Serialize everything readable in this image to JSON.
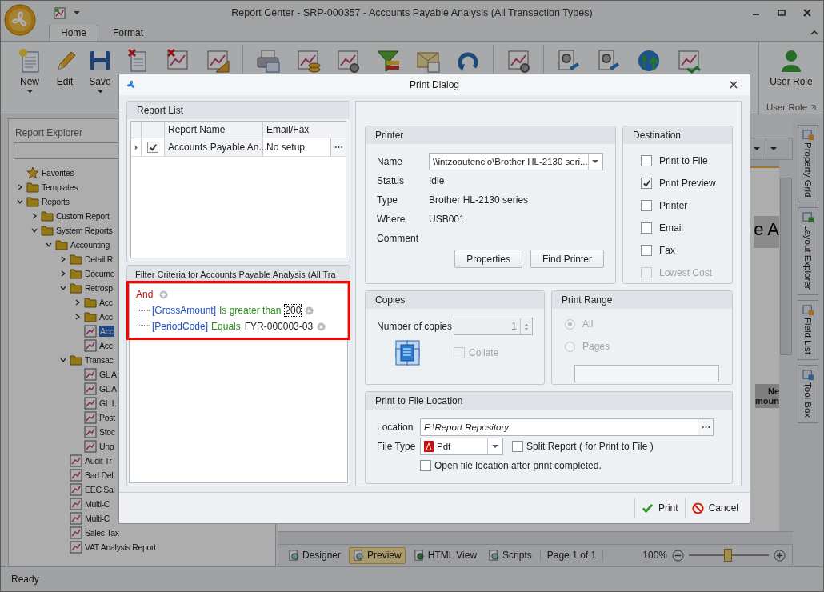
{
  "window": {
    "title": "Report Center - SRP-000357 - Accounts Payable Analysis (All Transaction Types)"
  },
  "ribbon": {
    "tabs": [
      {
        "label": "Home",
        "selected": true
      },
      {
        "label": "Format",
        "selected": false
      }
    ],
    "buttons": [
      {
        "label": "New",
        "dropdown": true
      },
      {
        "label": "Edit",
        "dropdown": false
      },
      {
        "label": "Save",
        "dropdown": true
      }
    ],
    "user_role": {
      "button": "User Role",
      "group": "User Role"
    }
  },
  "report_explorer": {
    "title": "Report Explorer",
    "tree": [
      {
        "label": "Favorites",
        "kind": "favorites",
        "selected": false
      },
      {
        "label": "Templates",
        "kind": "folder",
        "expanded": false,
        "selected": false
      },
      {
        "label": "Reports",
        "kind": "folder",
        "expanded": true,
        "selected": false,
        "children": [
          {
            "label": "Custom Report",
            "kind": "folder",
            "expanded": false,
            "selected": false
          },
          {
            "label": "System Reports",
            "kind": "folder",
            "expanded": true,
            "selected": false,
            "children": [
              {
                "label": "Accounting",
                "kind": "folder",
                "expanded": true,
                "selected": false,
                "children": [
                  {
                    "label": "Detail R",
                    "kind": "folder",
                    "expanded": false,
                    "selected": false
                  },
                  {
                    "label": "Docume",
                    "kind": "folder",
                    "expanded": false,
                    "selected": false
                  },
                  {
                    "label": "Retrosp",
                    "kind": "folder",
                    "expanded": true,
                    "selected": false,
                    "children": [
                      {
                        "label": "Acc",
                        "kind": "folder",
                        "expanded": false,
                        "selected": false
                      },
                      {
                        "label": "Acc",
                        "kind": "folder",
                        "expanded": false,
                        "selected": false
                      },
                      {
                        "label": "Acc",
                        "kind": "report",
                        "selected": true
                      },
                      {
                        "label": "Acc",
                        "kind": "report",
                        "selected": false
                      }
                    ]
                  },
                  {
                    "label": "Transac",
                    "kind": "folder",
                    "expanded": true,
                    "selected": false,
                    "children": [
                      {
                        "label": "GL A",
                        "kind": "report",
                        "selected": false
                      },
                      {
                        "label": "GL A",
                        "kind": "report",
                        "selected": false
                      },
                      {
                        "label": "GL L",
                        "kind": "report",
                        "selected": false
                      },
                      {
                        "label": "Post",
                        "kind": "report",
                        "selected": false
                      },
                      {
                        "label": "Stoc",
                        "kind": "report",
                        "selected": false
                      },
                      {
                        "label": "Unp",
                        "kind": "report",
                        "selected": false
                      }
                    ]
                  },
                  {
                    "label": "Audit Tr",
                    "kind": "report",
                    "selected": false
                  },
                  {
                    "label": "Bad Del",
                    "kind": "report",
                    "selected": false
                  },
                  {
                    "label": "EEC Sal",
                    "kind": "report",
                    "selected": false
                  },
                  {
                    "label": "Multi-C",
                    "kind": "report",
                    "selected": false
                  },
                  {
                    "label": "Multi-C",
                    "kind": "report",
                    "selected": false
                  },
                  {
                    "label": "Sales Tax",
                    "kind": "report",
                    "selected": false
                  },
                  {
                    "label": "VAT Analysis Report",
                    "kind": "report",
                    "selected": false
                  }
                ]
              }
            ]
          }
        ]
      }
    ]
  },
  "preview": {
    "heading_fragment": "e A",
    "column_fragments": [
      "Ne",
      "moun"
    ]
  },
  "dock_tabs": [
    "Property Grid",
    "Layout Explorer",
    "Field List",
    "Tool Box"
  ],
  "preview_toolbar": {
    "modes": [
      {
        "label": "Designer",
        "selected": false
      },
      {
        "label": "Preview",
        "selected": true
      },
      {
        "label": "HTML View",
        "selected": false
      },
      {
        "label": "Scripts",
        "selected": false
      }
    ],
    "page": "Page 1 of 1",
    "zoom": "100%",
    "zoom_slider": {
      "level": 0.48
    }
  },
  "status_bar": "Ready",
  "dialog": {
    "title": "Print Dialog",
    "report_list": {
      "title": "Report List",
      "columns": [
        "Report Name",
        "Email/Fax"
      ],
      "rows": [
        {
          "checked": true,
          "name": "Accounts Payable An...",
          "email_fax": "No setup"
        }
      ]
    },
    "filter": {
      "title": "Filter Criteria for Accounts Payable Analysis (All Tra",
      "group": "And",
      "conditions": [
        {
          "field": "[GrossAmount]",
          "operator": "Is greater than",
          "value": "200",
          "focused": true
        },
        {
          "field": "[PeriodCode]",
          "operator": "Equals",
          "value": "FYR-000003-03",
          "focused": false
        }
      ]
    },
    "printer": {
      "title": "Printer",
      "name_label": "Name",
      "name": "\\\\intzoautencio\\Brother HL-2130 seri...",
      "fields": [
        {
          "label": "Status",
          "value": "Idle"
        },
        {
          "label": "Type",
          "value": "Brother HL-2130 series"
        },
        {
          "label": "Where",
          "value": "USB001"
        },
        {
          "label": "Comment"
        }
      ],
      "buttons": [
        "Properties",
        "Find Printer"
      ]
    },
    "destination": {
      "title": "Destination",
      "options": [
        {
          "label": "Print to File",
          "checked": false,
          "disabled": false
        },
        {
          "label": "Print Preview",
          "checked": true,
          "disabled": false
        },
        {
          "label": "Printer",
          "checked": false,
          "disabled": false
        },
        {
          "label": "Email",
          "checked": false,
          "disabled": false
        },
        {
          "label": "Fax",
          "checked": false,
          "disabled": false
        },
        {
          "label": "Lowest Cost",
          "checked": false,
          "disabled": true
        }
      ]
    },
    "copies": {
      "title": "Copies",
      "label": "Number of copies",
      "value": "1",
      "disabled": true,
      "collate": {
        "label": "Collate",
        "checked": false,
        "disabled": true
      }
    },
    "print_range": {
      "title": "Print Range",
      "options": [
        {
          "label": "All",
          "selected": true,
          "disabled": true
        },
        {
          "label": "Pages",
          "selected": false,
          "disabled": true
        }
      ]
    },
    "file_location": {
      "title": "Print to File Location",
      "location_label": "Location",
      "location": "F:\\Report Repository",
      "file_type_label": "File Type",
      "file_type": "Pdf",
      "split": {
        "label": "Split Report ( for Print to File )",
        "checked": false
      },
      "open_after": {
        "label": "Open file location after print completed.",
        "checked": false
      }
    },
    "actions": [
      {
        "label": "Print",
        "kind": "confirm"
      },
      {
        "label": "Cancel",
        "kind": "cancel"
      }
    ]
  }
}
